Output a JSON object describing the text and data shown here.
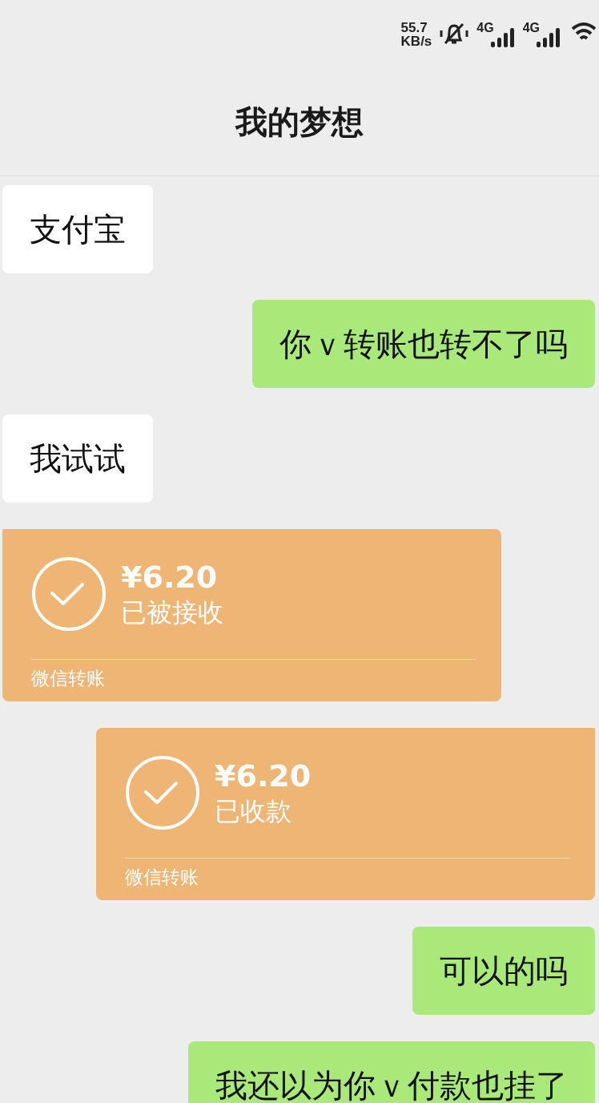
{
  "status_bar": {
    "speed_value": "55.7",
    "speed_unit": "KB/s",
    "networks": [
      "4G",
      "4G"
    ]
  },
  "header": {
    "title": "我的梦想"
  },
  "messages": [
    {
      "kind": "text",
      "outgoing": false,
      "text": "支付宝"
    },
    {
      "kind": "text",
      "outgoing": true,
      "text": "你ｖ转账也转不了吗"
    },
    {
      "kind": "text",
      "outgoing": false,
      "text": "我试试"
    },
    {
      "kind": "transfer",
      "outgoing": false,
      "amount": "¥6.20",
      "status": "已被接收",
      "footer": "微信转账"
    },
    {
      "kind": "transfer",
      "outgoing": true,
      "amount": "¥6.20",
      "status": "已收款",
      "footer": "微信转账"
    },
    {
      "kind": "text",
      "outgoing": true,
      "text": "可以的吗"
    },
    {
      "kind": "text",
      "outgoing": true,
      "text": "我还以为你ｖ付款也挂了"
    }
  ]
}
